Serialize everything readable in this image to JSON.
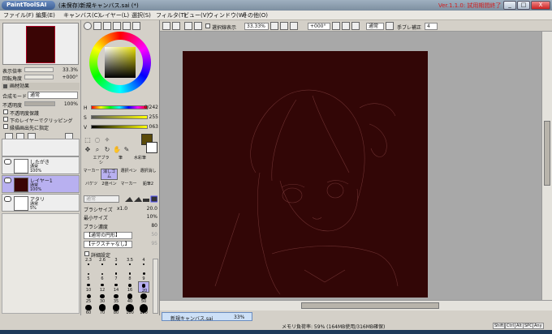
{
  "window": {
    "app_logo": "PaintToolSAI",
    "title": "(未保存)新規キャンバス.sai (*)",
    "version_notice": "Ver.1.1.0: 試用期間終了",
    "controls": [
      "_",
      "□",
      "X"
    ]
  },
  "menu": [
    "ファイル(F)",
    "編集(E)",
    "キャンバス(C)",
    "レイヤー(L)",
    "選択(S)",
    "フィルタ(T)",
    "ビュー(V)",
    "ウィンドウ(W)",
    "その他(O)"
  ],
  "navigator": {
    "zoom_label": "表示倍率",
    "zoom_value": "33.3%",
    "rotation_label": "回転角度",
    "rotation_value": "+000°"
  },
  "layer_effects": {
    "header": "画材効果",
    "blend_label": "合成モード",
    "blend_value": "通常",
    "opacity_label": "不透明度",
    "opacity_value": "100%",
    "options": [
      "不透明度保護",
      "下のレイヤーでクリッピング",
      "縁描画出先に指定"
    ]
  },
  "layers": [
    {
      "name": "したがき",
      "mode": "通常",
      "opacity": "100%",
      "selected": false
    },
    {
      "name": "レイヤー1",
      "mode": "通常",
      "opacity": "100%",
      "selected": true
    },
    {
      "name": "アタリ",
      "mode": "通常",
      "opacity": "5%",
      "selected": false
    }
  ],
  "color": {
    "h_label": "H",
    "h_value": "0/242",
    "s_label": "S",
    "s_value": "255",
    "v_label": "V",
    "v_value": "063",
    "primary": "#3d0e08",
    "secondary": "#ffffff",
    "accent_swatch": "#5a4a0a"
  },
  "tools": {
    "row1": [
      "エアブラシ",
      "筆",
      "水彩筆"
    ],
    "row2": [
      "マーカー",
      "消しゴム",
      "選択ペン",
      "選択消し"
    ],
    "row3": [
      "バケツ",
      "2値ペン",
      "マーカー",
      "鉛筆2"
    ]
  },
  "brush": {
    "mode_value": "通常",
    "size_label": "ブラシサイズ",
    "size_mult": "x1.0",
    "size_value": "20.0",
    "min_label": "最小サイズ",
    "min_value": "10%",
    "density_label": "ブラシ濃度",
    "density_value": "80",
    "shape_value": "【通常の円形】",
    "texture_value": "【テクスチャなし】",
    "shape_strength": "50",
    "texture_strength": "95",
    "detail_label": "詳細設定",
    "sizes": [
      "2.3",
      "2.6",
      "3",
      "3.5",
      "4",
      "5",
      "6",
      "7",
      "8",
      "9",
      "10",
      "12",
      "14",
      "16",
      "20",
      "25",
      "30",
      "35",
      "40",
      "50",
      "60",
      "70",
      "80",
      "100",
      "120"
    ]
  },
  "canvas_toolbar": {
    "selection_display": "選択線表示",
    "zoom": "33.33%",
    "rotation": "+000°",
    "mode": "通常",
    "stabilizer_label": "手ブレ補正",
    "stabilizer_value": "4"
  },
  "canvas": {
    "color": "#320606"
  },
  "tab": {
    "name": "新規キャンバス.sai",
    "zoom": "33%"
  },
  "status": {
    "memory": "メモリ負荷率: 59% (164MB使用/316MB確保)",
    "keys": [
      "Shift",
      "Ctrl",
      "Alt",
      "SPC",
      "Any"
    ]
  }
}
